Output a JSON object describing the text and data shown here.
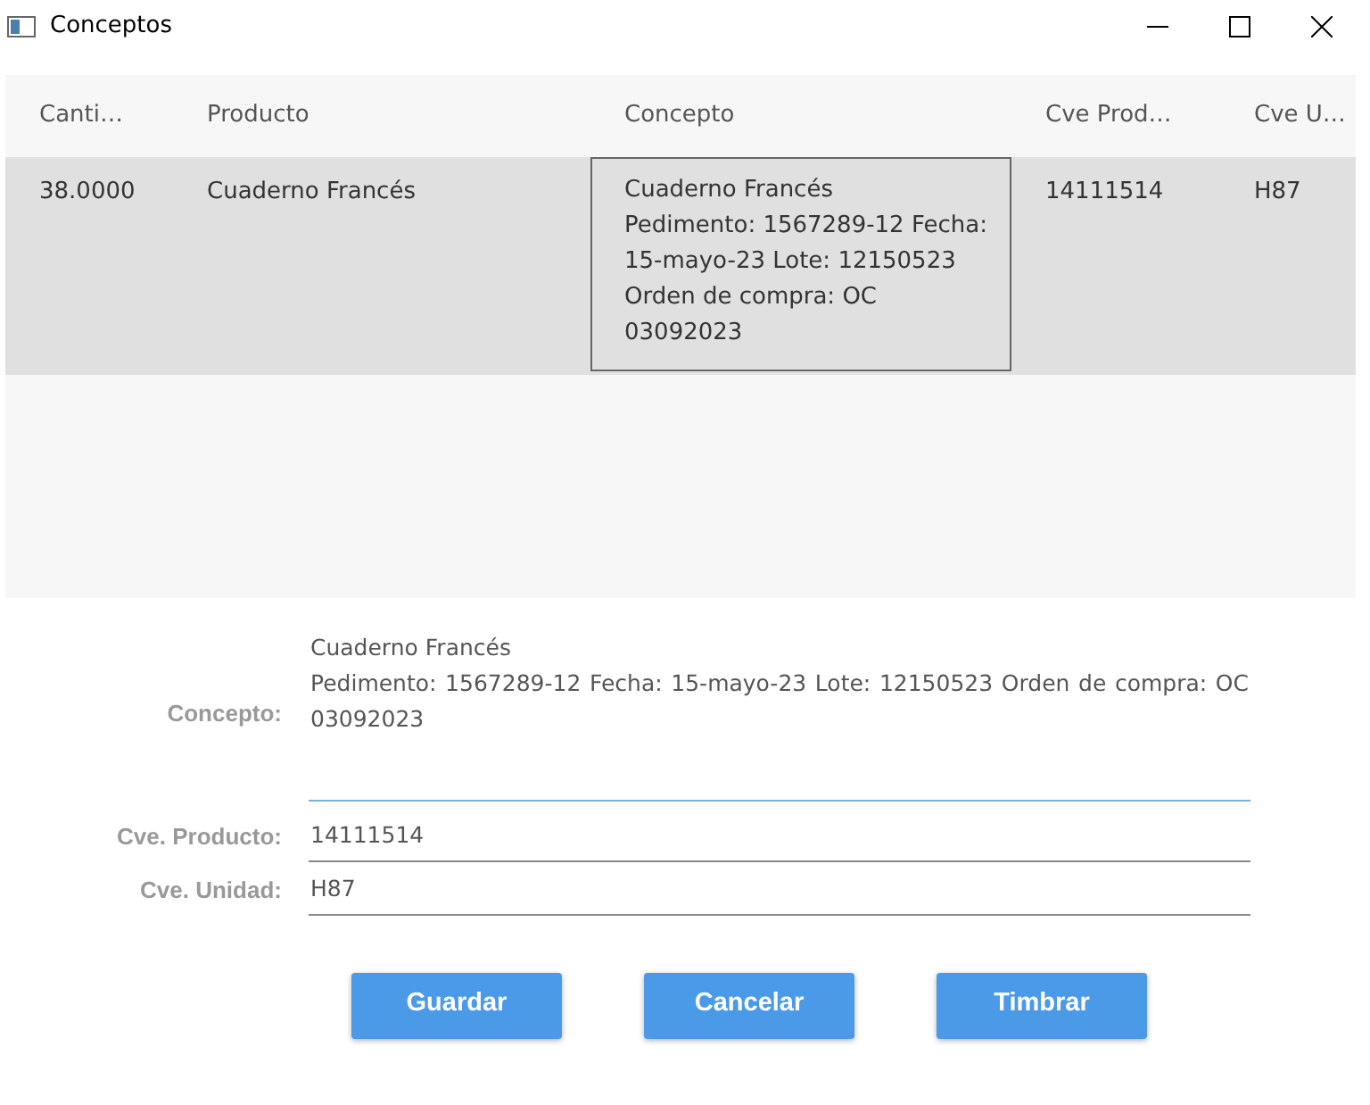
{
  "window": {
    "title": "Conceptos"
  },
  "table": {
    "columns": [
      "Canti…",
      "Producto",
      "Concepto",
      "Cve Prod…",
      "Cve U…"
    ],
    "rows": [
      {
        "selected": true,
        "cells": [
          {
            "text": "38.0000",
            "focused": false
          },
          {
            "text": "Cuaderno Francés",
            "focused": false
          },
          {
            "text": "Cuaderno Francés\nPedimento: 1567289-12 Fecha: 15-mayo-23 Lote: 12150523 Orden de compra: OC 03092023",
            "focused": true
          },
          {
            "text": "14111514",
            "focused": false
          },
          {
            "text": "H87",
            "focused": false
          }
        ]
      }
    ]
  },
  "form": {
    "fields": [
      {
        "kind": "multiline",
        "label": "Concepto:",
        "value": "Cuaderno Francés\nPedimento: 1567289-12 Fecha: 15-mayo-23 Lote: 12150523 Orden de compra: OC 03092023",
        "focused": true
      },
      {
        "kind": "single",
        "label": "Cve. Producto:",
        "value": "14111514",
        "focused": false
      },
      {
        "kind": "single",
        "label": "Cve. Unidad:",
        "value": "H87",
        "focused": false
      }
    ]
  },
  "buttons": [
    "Guardar",
    "Cancelar",
    "Timbrar"
  ]
}
